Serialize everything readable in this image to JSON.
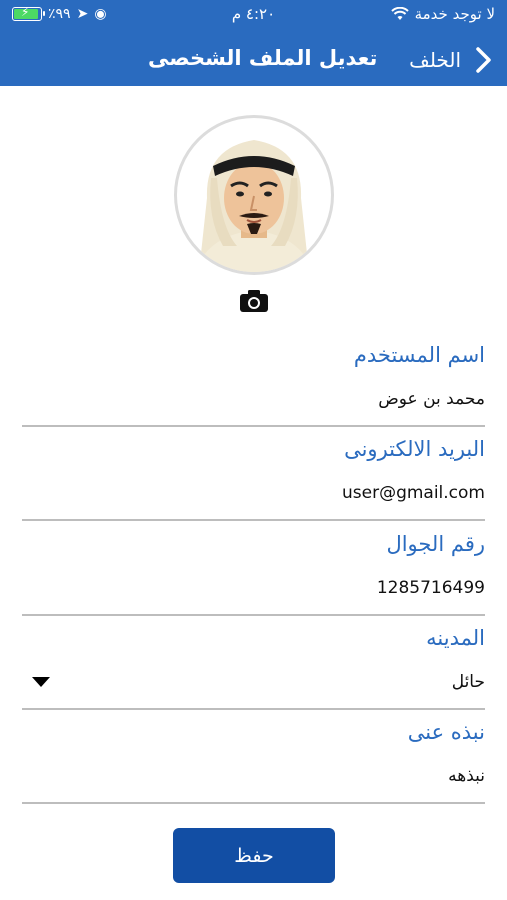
{
  "status_bar": {
    "battery_percent": "٪٩٩",
    "time": "٤:٢٠ م",
    "carrier": "لا توجد خدمة",
    "battery_level": 0.99
  },
  "nav": {
    "back_label": "الخلف",
    "title": "تعديل الملف الشخصى"
  },
  "avatar": {
    "icon": "user-avatar-illustration"
  },
  "form": {
    "username": {
      "label": "اسم المستخدم",
      "value": "محمد بن عوض"
    },
    "email": {
      "label": "البريد الالكترونى",
      "value": "user@gmail.com"
    },
    "phone": {
      "label": "رقم الجوال",
      "value": "1285716499"
    },
    "city": {
      "label": "المدينه",
      "value": "حائل"
    },
    "bio": {
      "label": "نبذه عنى",
      "value": "نبذهه"
    }
  },
  "actions": {
    "save_label": "حفظ"
  },
  "colors": {
    "primary": "#2a6bbf",
    "button": "#124ea4",
    "label": "#2a6bbf"
  }
}
